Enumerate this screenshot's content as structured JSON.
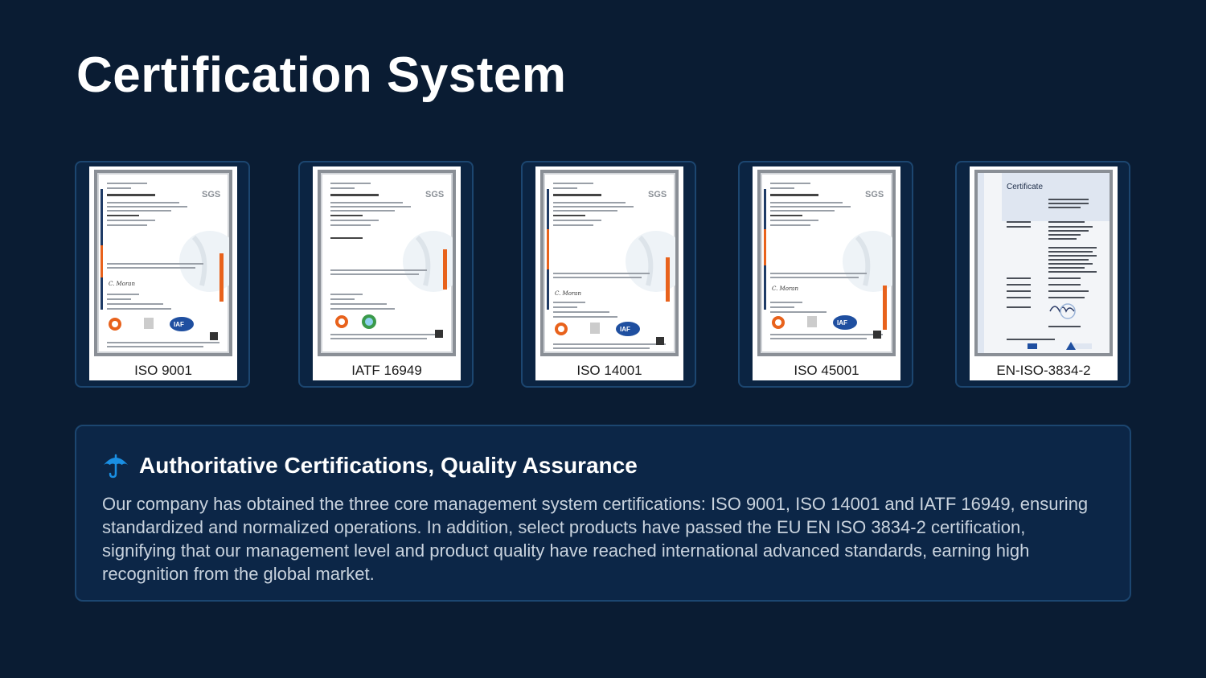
{
  "page": {
    "title": "Certification System"
  },
  "certificates": [
    {
      "label": "ISO 9001",
      "issuer": "SGS",
      "style": "sgs"
    },
    {
      "label": "IATF 16949",
      "issuer": "SGS",
      "style": "sgs"
    },
    {
      "label": "ISO 14001",
      "issuer": "SGS",
      "style": "sgs"
    },
    {
      "label": "ISO 45001",
      "issuer": "SGS",
      "style": "sgs"
    },
    {
      "label": "EN-ISO-3834-2",
      "issuer": "Certificate",
      "style": "tuv"
    }
  ],
  "info": {
    "icon": "umbrella-icon",
    "title": "Authoritative Certifications, Quality Assurance",
    "body": "Our company has obtained the three core management system certifications: ISO 9001, ISO 14001 and IATF 16949, ensuring standardized and normalized operations. In addition, select products have passed the EU EN ISO 3834-2 certification, signifying that our management level and product quality have reached international advanced standards, earning high recognition from the global market."
  },
  "colors": {
    "background": "#0a1c33",
    "card_border": "#1c4670",
    "panel_bg": "#0c2647",
    "accent_icon": "#1a8fe3",
    "cert_orange": "#e8621c"
  }
}
